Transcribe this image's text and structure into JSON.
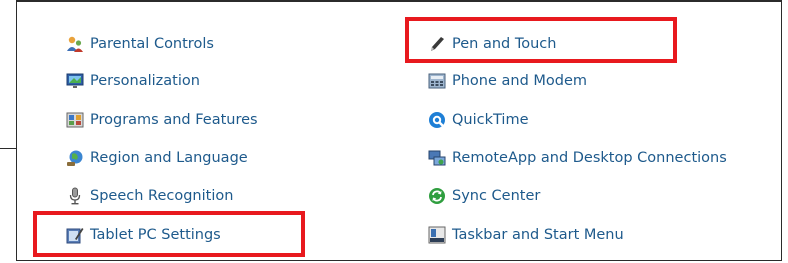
{
  "control_panel": {
    "left_column": [
      {
        "label": "Parental Controls",
        "icon": "parental-controls-icon"
      },
      {
        "label": "Personalization",
        "icon": "personalization-icon"
      },
      {
        "label": "Programs and Features",
        "icon": "programs-features-icon"
      },
      {
        "label": "Region and Language",
        "icon": "region-language-icon"
      },
      {
        "label": "Speech Recognition",
        "icon": "microphone-icon"
      },
      {
        "label": "Tablet PC Settings",
        "icon": "tablet-pen-icon"
      }
    ],
    "right_column": [
      {
        "label": "Pen and Touch",
        "icon": "pen-icon"
      },
      {
        "label": "Phone and Modem",
        "icon": "phone-modem-icon"
      },
      {
        "label": "QuickTime",
        "icon": "quicktime-icon"
      },
      {
        "label": "RemoteApp and Desktop Connections",
        "icon": "remoteapp-icon"
      },
      {
        "label": "Sync Center",
        "icon": "sync-center-icon"
      },
      {
        "label": "Taskbar and Start Menu",
        "icon": "taskbar-icon"
      }
    ]
  },
  "highlight_color": "#e8191e",
  "link_color": "#1e5a8c"
}
